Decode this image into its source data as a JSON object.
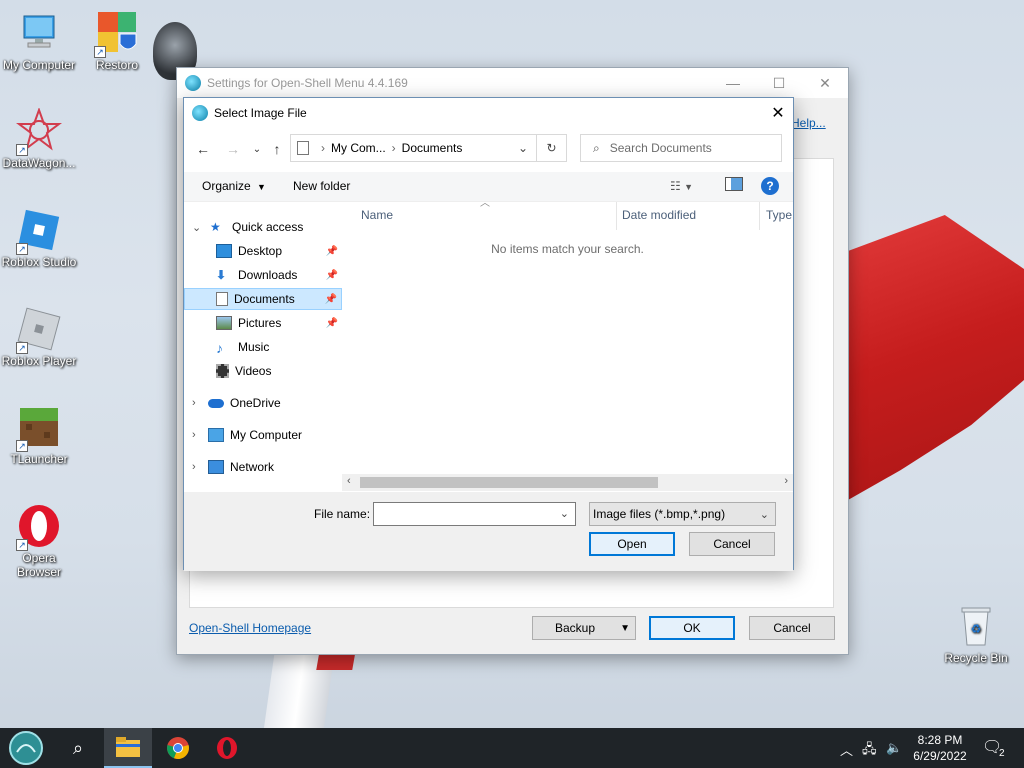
{
  "desktop": {
    "icons": [
      {
        "label": "My Computer",
        "icon": "computer-icon"
      },
      {
        "label": "Restoro",
        "icon": "restoro-icon"
      },
      {
        "label": "DataWagon...",
        "icon": "datawagon-icon"
      },
      {
        "label": "Roblox Studio",
        "icon": "roblox-studio-icon"
      },
      {
        "label": "Roblox Player",
        "icon": "roblox-player-icon"
      },
      {
        "label": "TLauncher",
        "icon": "tlauncher-icon"
      },
      {
        "label": "Opera Browser",
        "icon": "opera-icon"
      },
      {
        "label": "Recycle Bin",
        "icon": "recycle-bin-icon"
      }
    ]
  },
  "settings_window": {
    "title": "Settings for Open-Shell Menu 4.4.169",
    "help_link": "Help...",
    "homepage_link": "Open-Shell Homepage",
    "backup_label": "Backup",
    "ok_label": "OK",
    "cancel_label": "Cancel"
  },
  "dialog": {
    "title": "Select Image File",
    "breadcrumb": [
      "My Com...",
      "Documents"
    ],
    "search_placeholder": "Search Documents",
    "toolbar": {
      "organize": "Organize",
      "new_folder": "New folder"
    },
    "nav": {
      "quick_access": "Quick access",
      "items": [
        {
          "label": "Desktop",
          "pinned": true
        },
        {
          "label": "Downloads",
          "pinned": true
        },
        {
          "label": "Documents",
          "pinned": true,
          "selected": true
        },
        {
          "label": "Pictures",
          "pinned": true
        },
        {
          "label": "Music",
          "pinned": false
        },
        {
          "label": "Videos",
          "pinned": false
        }
      ],
      "onedrive": "OneDrive",
      "my_computer": "My Computer",
      "network": "Network"
    },
    "columns": [
      "Name",
      "Date modified",
      "Type"
    ],
    "empty_message": "No items match your search.",
    "file_name_label": "File name:",
    "file_name_value": "",
    "file_type": "Image files (*.bmp,*.png)",
    "open_label": "Open",
    "cancel_label": "Cancel"
  },
  "taskbar": {
    "time": "8:28 PM",
    "date": "6/29/2022",
    "notification_count": "2",
    "apps": [
      "start-orb",
      "search",
      "file-explorer",
      "chrome",
      "opera"
    ]
  }
}
